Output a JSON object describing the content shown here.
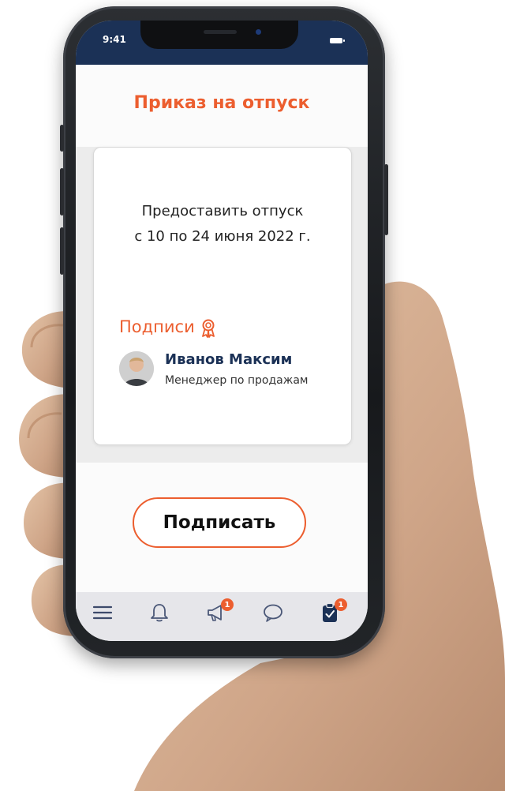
{
  "status_bar": {
    "time": "9:41"
  },
  "screen": {
    "title": "Приказ на отпуск"
  },
  "order": {
    "line1": "Предоставить отпуск",
    "line2": "с 10 по 24 июня 2022 г."
  },
  "signatures": {
    "label": "Подписи",
    "icon": "award-icon",
    "signer": {
      "name": "Иванов Максим",
      "role": "Менеджер по продажам"
    }
  },
  "actions": {
    "sign_label": "Подписать"
  },
  "tabbar": {
    "items": [
      {
        "icon": "menu-icon"
      },
      {
        "icon": "bell-icon"
      },
      {
        "icon": "megaphone-icon",
        "badge": "1"
      },
      {
        "icon": "chat-icon"
      },
      {
        "icon": "clipboard-check-icon",
        "badge": "1"
      }
    ]
  },
  "colors": {
    "accent": "#ec5e2f",
    "navy": "#1b3156"
  }
}
